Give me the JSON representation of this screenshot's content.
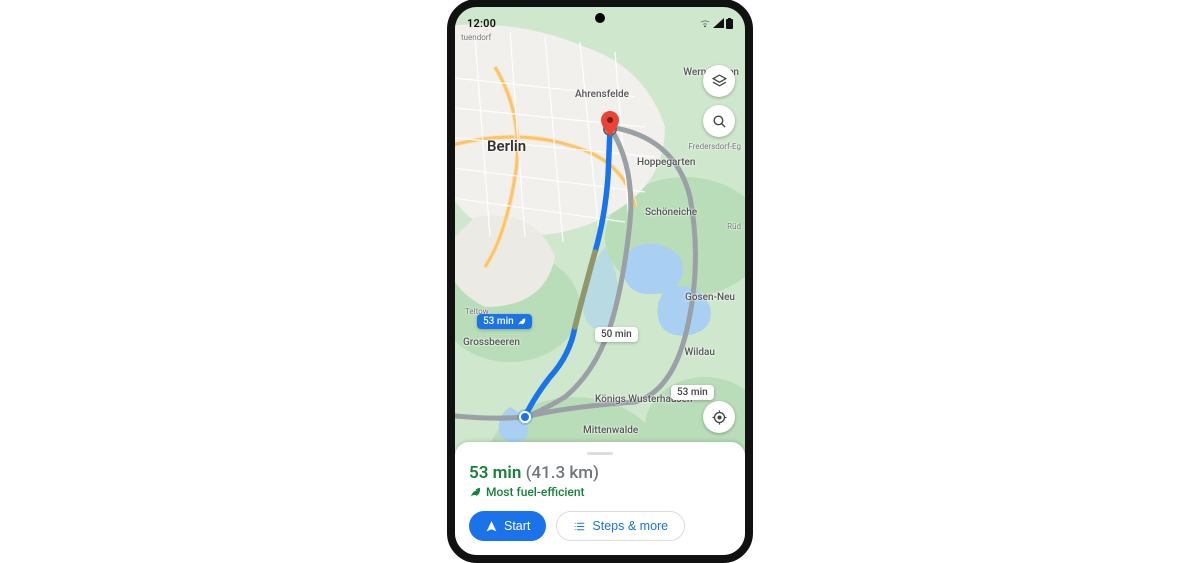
{
  "status_bar": {
    "time": "12:00"
  },
  "city_label": "Berlin",
  "places": {
    "ahrensfelde": "Ahrensfelde",
    "werneuchen": "Werneuchen",
    "hoppegarten": "Hoppegarten",
    "fredersdorf": "Fredersdorf-Eg",
    "schoneiche": "Schöneiche",
    "rud": "Rüd",
    "teltow": "Teltow",
    "grossbeeren": "Grossbeeren",
    "konigs": "Königs Wusterhausen",
    "mittenwalde": "Mittenwalde",
    "wildau": "Wildau",
    "gosen": "Gosen-Neu",
    "tuendorf": "tuendorf"
  },
  "route": {
    "primary_chip": "53 min",
    "alt1_chip": "50 min",
    "alt2_chip": "53 min"
  },
  "sheet": {
    "duration": "53 min",
    "distance": "(41.3 km)",
    "eco_label": "Most fuel-efficient",
    "start_label": "Start",
    "steps_label": "Steps & more"
  }
}
